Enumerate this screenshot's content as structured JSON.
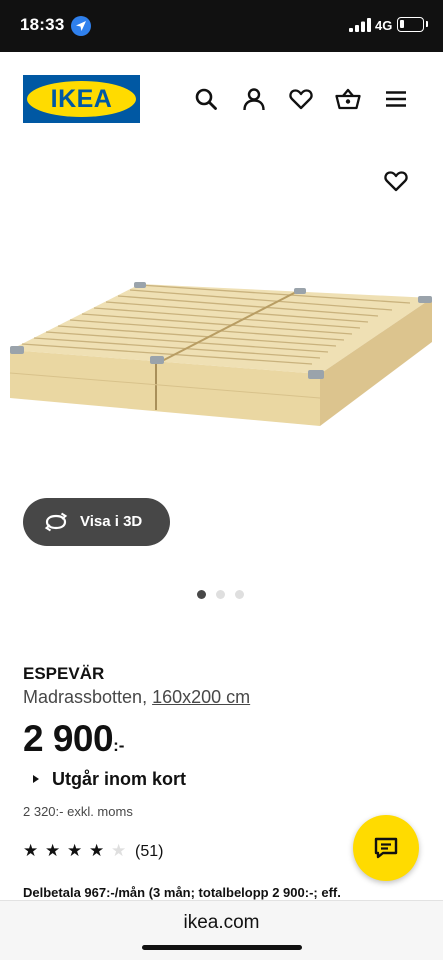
{
  "status_bar": {
    "time": "18:33",
    "network": "4G",
    "battery_percent": 15
  },
  "header": {
    "logo_text": "IKEA",
    "icons": [
      "search-icon",
      "account-icon",
      "wishlist-icon",
      "cart-icon",
      "menu-icon"
    ]
  },
  "gallery": {
    "view_3d_label": "Visa i 3D",
    "dot_count": 3,
    "active_dot": 0
  },
  "product": {
    "name": "ESPEVÄR",
    "description": "Madrassbotten,",
    "size": "160x200 cm",
    "price": "2 900",
    "price_suffix": ":-",
    "stock_status": "Utgår inom kort",
    "price_ex_vat": "2 320:- exkl. moms",
    "rating": 4,
    "rating_max": 5,
    "review_count": "(51)",
    "installment": "Delbetala 967:-/mån (3 mån; totalbelopp 2 900:-; eff."
  },
  "browser": {
    "url": "ikea.com"
  },
  "colors": {
    "ikea_blue": "#0058a3",
    "ikea_yellow": "#ffdb00",
    "text": "#111111",
    "muted": "#484848"
  }
}
